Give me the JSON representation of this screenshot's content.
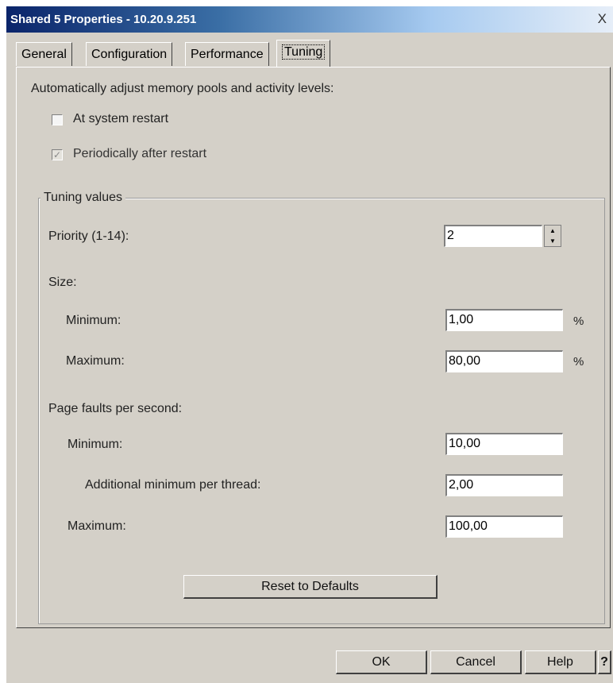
{
  "window": {
    "title": "Shared 5 Properties - 10.20.9.251",
    "close_glyph": "X"
  },
  "tabs": [
    {
      "label": "General"
    },
    {
      "label": "Configuration"
    },
    {
      "label": "Performance"
    },
    {
      "label": "Tuning",
      "active": true
    }
  ],
  "tuning": {
    "intro": "Automatically adjust memory pools and activity levels:",
    "at_restart": {
      "label": "At system restart",
      "checked": false
    },
    "periodically": {
      "label": "Periodically after restart",
      "checked": true,
      "enabled": false
    },
    "group_title": "Tuning values",
    "priority": {
      "label": "Priority (1-14):",
      "value": "2"
    },
    "size": {
      "label": "Size:",
      "minimum": {
        "label": "Minimum:",
        "value": "1,00",
        "unit": "%"
      },
      "maximum": {
        "label": "Maximum:",
        "value": "80,00",
        "unit": "%"
      }
    },
    "page_faults": {
      "label": "Page faults per second:",
      "minimum": {
        "label": "Minimum:",
        "value": "10,00"
      },
      "additional": {
        "label": "Additional minimum per thread:",
        "value": "2,00"
      },
      "maximum": {
        "label": "Maximum:",
        "value": "100,00"
      }
    },
    "reset_label": "Reset to Defaults"
  },
  "footer": {
    "ok": "OK",
    "cancel": "Cancel",
    "help": "Help",
    "whats_this": "?"
  }
}
